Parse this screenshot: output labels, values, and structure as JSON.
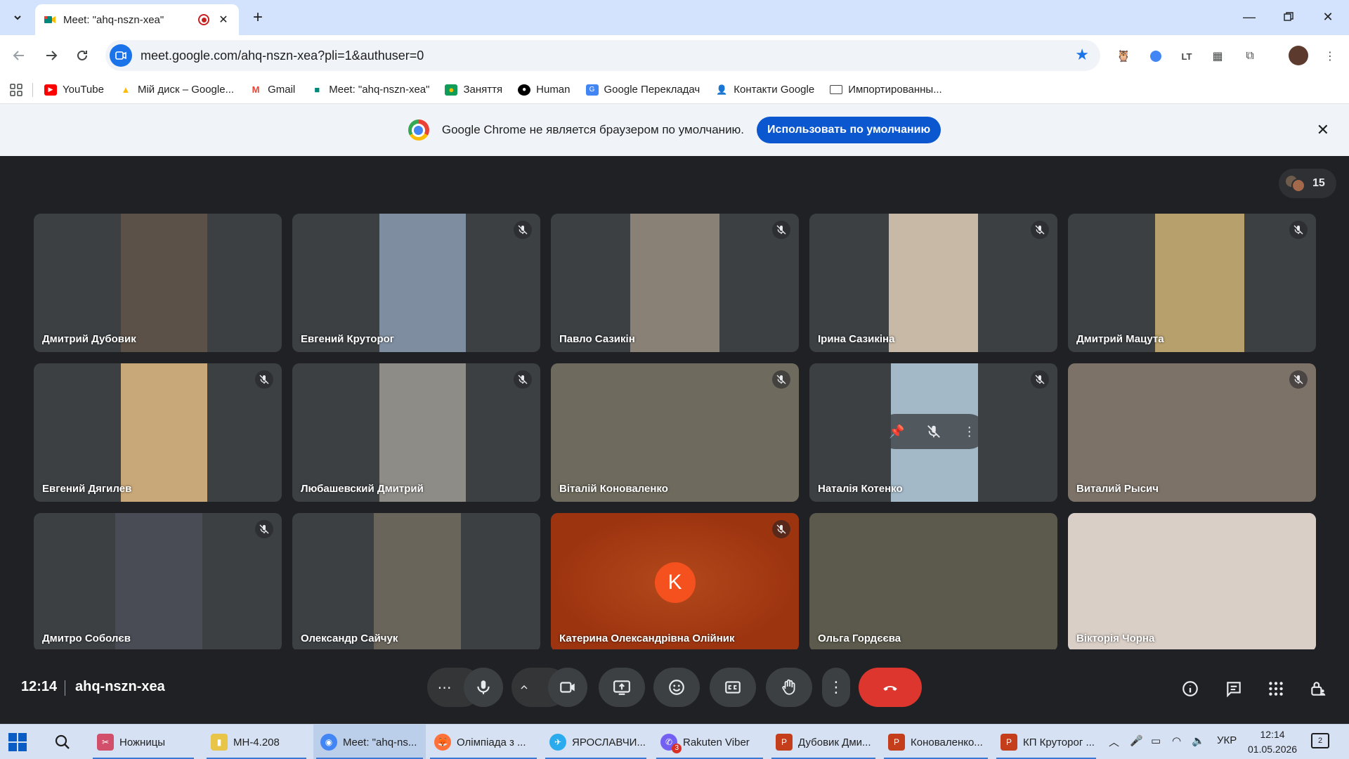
{
  "browser": {
    "tab_title": "Meet: \"ahq-nszn-xea\"",
    "url": "meet.google.com/ahq-nszn-xea?pli=1&authuser=0",
    "bookmarks": [
      {
        "label": "YouTube",
        "icon": "youtube-icon",
        "color": "#ff0000"
      },
      {
        "label": "Мій диск – Google...",
        "icon": "drive-icon",
        "color": "#fbbc04"
      },
      {
        "label": "Gmail",
        "icon": "gmail-icon",
        "color": "#ea4335"
      },
      {
        "label": "Meet: \"ahq-nszn-xea\"",
        "icon": "meet-icon",
        "color": "#00897b"
      },
      {
        "label": "Заняття",
        "icon": "classroom-icon",
        "color": "#0f9d58"
      },
      {
        "label": "Human",
        "icon": "human-icon",
        "color": "#000000"
      },
      {
        "label": "Google Перекладач",
        "icon": "translate-icon",
        "color": "#4285f4"
      },
      {
        "label": "Контакти Google",
        "icon": "contacts-icon",
        "color": "#1a73e8"
      },
      {
        "label": "Импортированны...",
        "icon": "folder-icon",
        "color": "#5f6368"
      }
    ]
  },
  "infobar": {
    "message": "Google Chrome не является браузером по умолчанию.",
    "button": "Использовать по умолчанию"
  },
  "meet": {
    "participant_count": "15",
    "participants": [
      {
        "name": "Дмитрий Дубовик",
        "muted": false,
        "video": "#5b5148"
      },
      {
        "name": "Евгений Круторог",
        "muted": true,
        "video": "#7e8ea0"
      },
      {
        "name": "Павло Сазикін",
        "muted": true,
        "video": "#8a8176"
      },
      {
        "name": "Ірина Сазикіна",
        "muted": true,
        "video": "#c8b9a6"
      },
      {
        "name": "Дмитрий Мацута",
        "muted": true,
        "video": "#b7a06c"
      },
      {
        "name": "Евгений Дягилев",
        "muted": true,
        "video": "#c8a878"
      },
      {
        "name": "Любашевский Дмитрий",
        "muted": true,
        "video": "#8d8c87"
      },
      {
        "name": "Віталій Коноваленко",
        "muted": true,
        "video": "#6e6a5d"
      },
      {
        "name": "Наталія Котенко",
        "muted": true,
        "video": "#a3b9c7"
      },
      {
        "name": "Виталий Рысич",
        "muted": true,
        "video": "#7c7268"
      },
      {
        "name": "Дмитро Соболєв",
        "muted": true,
        "video": "#4a4c55"
      },
      {
        "name": "Олександр Сайчук",
        "muted": false,
        "video": "#6a655b"
      },
      {
        "name": "Катерина Олександрівна Олійник",
        "muted": true,
        "video": "#9c3410",
        "initial": "K"
      },
      {
        "name": "Ольга Гордєєва",
        "muted": false,
        "video": "#5b5a4c"
      },
      {
        "name": "Вікторія Чорна",
        "muted": false,
        "video": "#d9cfc7"
      }
    ],
    "time": "12:14",
    "meeting_code": "ahq-nszn-xea"
  },
  "taskbar": {
    "items": [
      {
        "label": "Ножницы",
        "color": "#d14f6b"
      },
      {
        "label": "МН-4.208",
        "color": "#e8c547"
      },
      {
        "label": "Meet: \"ahq-ns...",
        "color": "#4285f4"
      },
      {
        "label": "Олімпіада з ...",
        "color": "#ff7139"
      },
      {
        "label": "ЯРОСЛАВЧИ...",
        "color": "#2aabee"
      },
      {
        "label": "Rakuten Viber",
        "color": "#7360f2"
      },
      {
        "label": "Дубовик Дми...",
        "color": "#c43e1c"
      },
      {
        "label": "Коноваленко...",
        "color": "#c43e1c"
      },
      {
        "label": "КП Круторог ...",
        "color": "#c43e1c"
      }
    ],
    "viber_badge": "3",
    "language": "УКР",
    "time": "12:14",
    "date": "01.05.2026",
    "notifications": "2"
  }
}
